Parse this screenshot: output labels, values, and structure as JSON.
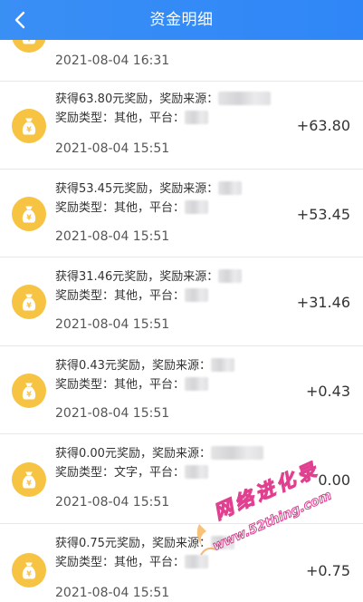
{
  "header": {
    "title": "资金明细",
    "back_icon": "chevron-left-icon"
  },
  "colors": {
    "header_blue": "#3a8ff5",
    "coin_gold": "#f6c343",
    "watermark_magenta": "#e0408f"
  },
  "watermark": {
    "line1": "网络进化录",
    "line2": "www.52thing.com"
  },
  "records": [
    {
      "text_a": "",
      "text_b": "",
      "date": "2021-08-04 16:31",
      "amount": ""
    },
    {
      "text_a": "获得63.80元奖励，奖励来源：",
      "text_b": "奖励类型：其他，平台：",
      "date": "2021-08-04 15:51",
      "amount": "+63.80"
    },
    {
      "text_a": "获得53.45元奖励，奖励来源：",
      "text_b": "奖励类型：其他，平台：",
      "date": "2021-08-04 15:51",
      "amount": "+53.45"
    },
    {
      "text_a": "获得31.46元奖励，奖励来源：",
      "text_b": "奖励类型：其他，平台：",
      "date": "2021-08-04 15:51",
      "amount": "+31.46"
    },
    {
      "text_a": "获得0.43元奖励，奖励来源：",
      "text_b": "奖励类型：其他，平台：",
      "date": "2021-08-04 15:51",
      "amount": "+0.43"
    },
    {
      "text_a": "获得0.00元奖励，奖励来源：",
      "text_b": "奖励类型：文字，平台：",
      "date": "2021-08-04 15:51",
      "amount": "0.00"
    },
    {
      "text_a": "获得0.75元奖励，奖励来源：",
      "text_b": "奖励类型：其他，平台：",
      "date": "2021-08-04 15:51",
      "amount": "+0.75"
    }
  ]
}
